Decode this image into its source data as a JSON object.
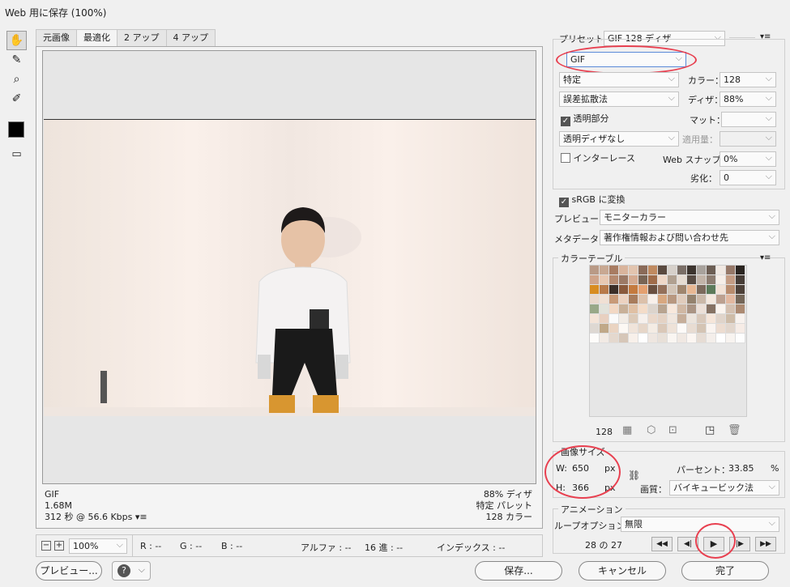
{
  "window": {
    "title": "Web 用に保存 (100%)"
  },
  "tools": [
    {
      "name": "hand-tool-icon",
      "glyph": "✋"
    },
    {
      "name": "slice-select-tool-icon",
      "glyph": "✎"
    },
    {
      "name": "zoom-tool-icon",
      "glyph": "⌕"
    },
    {
      "name": "eyedropper-tool-icon",
      "glyph": "✐"
    }
  ],
  "tabs": [
    "元画像",
    "最適化",
    "2 アップ",
    "4 アップ"
  ],
  "preview": {
    "format": "GIF",
    "size": "1.68M",
    "time": "312 秒 @ 56.6 Kbps",
    "dither": "88% ディザ",
    "palette": "特定 パレット",
    "colors": "128 カラー"
  },
  "status": {
    "zoom": "100%",
    "r": "R : --",
    "g": "G : --",
    "b": "B : --",
    "alpha": "アルファ : --",
    "hex": "16 進 : --",
    "index": "インデックス : --"
  },
  "buttons": {
    "preview": "プレビュー...",
    "save": "保存...",
    "cancel": "キャンセル",
    "done": "完了"
  },
  "settings": {
    "preset_label": "プリセット：",
    "preset_value": "GIF 128 ディザ",
    "format": "GIF",
    "reduction": "特定",
    "colors_label": "カラー：",
    "colors_value": "128",
    "dither_algo": "誤差拡散法",
    "dither_label": "ディザ：",
    "dither_value": "88%",
    "transparency": "透明部分",
    "matte_label": "マット：",
    "trans_dither": "透明ディザなし",
    "amount_label": "適用量：",
    "interlace": "インターレース",
    "websnap_label": "Web スナップ：",
    "websnap_value": "0%",
    "lossy_label": "劣化：",
    "lossy_value": "0",
    "srgb": "sRGB に変換",
    "preview_label": "プレビュー：",
    "preview_value": "モニターカラー",
    "metadata_label": "メタデータ：",
    "metadata_value": "著作権情報および問い合わせ先"
  },
  "color_table": {
    "title": "カラーテーブル",
    "count": "128"
  },
  "image_size": {
    "title": "画像サイズ",
    "w_label": "W:",
    "w_value": "650",
    "h_label": "H:",
    "h_value": "366",
    "unit": "px",
    "percent_label": "パーセント：",
    "percent_value": "33.85",
    "percent_unit": "%",
    "quality_label": "画質：",
    "quality_value": "バイキュービック法"
  },
  "animation": {
    "title": "アニメーション",
    "loop_label": "ループオプション：",
    "loop_value": "無限",
    "frame": "28 の 27",
    "controls": [
      "◀◀",
      "◀|",
      "▶",
      "|▶",
      "▶▶"
    ]
  },
  "palette_colors": [
    "#b99a86",
    "#c8a892",
    "#a87c62",
    "#d9b49c",
    "#e2c4ae",
    "#8a6a58",
    "#c08a60",
    "#5a4a40",
    "#d6d0ca",
    "#7a6e66",
    "#3c342e",
    "#a8a29c",
    "#6c5e54",
    "#f0e8e2",
    "#967868",
    "#2a2420",
    "#cfa48a",
    "#e8c8b2",
    "#b58a70",
    "#9c7a66",
    "#d4aa90",
    "#786454",
    "#a06c4a",
    "#efd8c8",
    "#b0a090",
    "#e6dcd2",
    "#584c44",
    "#c2b4a8",
    "#8c7c70",
    "#f6eee8",
    "#c49c84",
    "#463c36",
    "#d88c20",
    "#b87a4a",
    "#3a2e28",
    "#8a5a3c",
    "#c47a3e",
    "#e4a070",
    "#6a5040",
    "#94705a",
    "#d2c4b6",
    "#a0866e",
    "#e8b894",
    "#7c6a5c",
    "#5c7a5a",
    "#f2e2d6",
    "#b88c6e",
    "#4c4038",
    "#e8d8cc",
    "#f0e0d4",
    "#c89a78",
    "#ecd2c0",
    "#a87c5c",
    "#dcc0aa",
    "#f8f0ea",
    "#d8a880",
    "#b89880",
    "#e0ccbc",
    "#94826e",
    "#cab8a8",
    "#f4e8de",
    "#bca090",
    "#e2b8a0",
    "#746658",
    "#98a888",
    "#e2e2da",
    "#f2d8c4",
    "#c8b098",
    "#e0c0a4",
    "#f4dcc8",
    "#dcd4cc",
    "#b8a490",
    "#f8e8dc",
    "#d0b8a4",
    "#aa9484",
    "#ece0d8",
    "#867264",
    "#fbf4ee",
    "#d4c0b0",
    "#ac8a72",
    "#f4e4d8",
    "#e8d0c0",
    "#fafafa",
    "#f2ece6",
    "#dccab8",
    "#f6f0ec",
    "#ead8ca",
    "#e4d2c4",
    "#f0e6de",
    "#c6ae9a",
    "#ece4dc",
    "#d8c8ba",
    "#f6e6da",
    "#e0d4ca",
    "#cebca8",
    "#f8f2ee",
    "#ded8d2",
    "#c0a888",
    "#ead4c2",
    "#fcf8f4",
    "#f0e4da",
    "#e6d6c8",
    "#f4ece4",
    "#dac8b8",
    "#eee2d8",
    "#fdfaf8",
    "#e8dcd2",
    "#d4c4b4",
    "#faf4f0",
    "#ecdcd0",
    "#e2d6cc",
    "#f6ece6",
    "#fefcfa",
    "#f2eae4",
    "#e4d8ce",
    "#d6c6b8",
    "#f8f0ea",
    "#ffffff",
    "#eee6e0",
    "#e8e0d8",
    "#faf6f2",
    "#f0e8e2",
    "#fcf6f2",
    "#e6dcd4",
    "#f4eeea",
    "#ffffff",
    "#f8f4f0",
    "#fefefe"
  ]
}
